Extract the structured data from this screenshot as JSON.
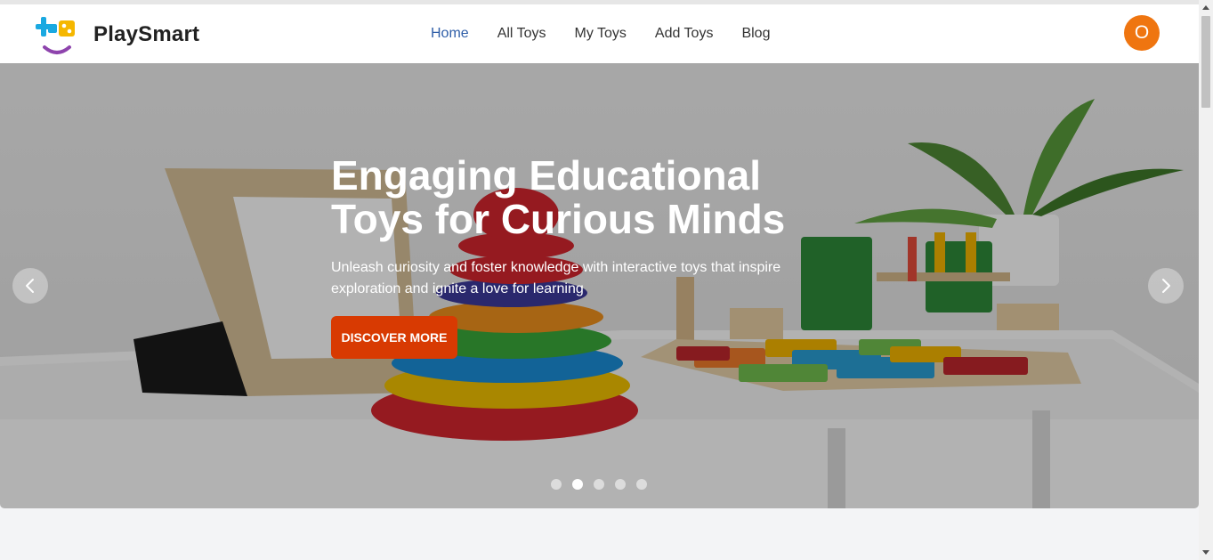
{
  "brand": {
    "name": "PlaySmart",
    "logo_icon": "toy-blocks-smile-logo"
  },
  "nav": {
    "links": [
      {
        "label": "Home",
        "active": true
      },
      {
        "label": "All Toys",
        "active": false
      },
      {
        "label": "My Toys",
        "active": false
      },
      {
        "label": "Add Toys",
        "active": false
      },
      {
        "label": "Blog",
        "active": false
      }
    ],
    "active_color": "#2f5ea8"
  },
  "user": {
    "avatar_text": "O",
    "avatar_color": "#ef7510"
  },
  "hero": {
    "title_line1": "Engaging Educational",
    "title_line2": "Toys for Curious Minds",
    "subtitle_line1": "Unleash curiosity and foster knowledge with interactive toys that inspire",
    "subtitle_line2": "exploration and ignite a love for learning",
    "cta_label": "DISCOVER MORE",
    "cta_color": "#d83a02",
    "prev_icon": "chevron-left-icon",
    "next_icon": "chevron-right-icon",
    "slides_count": 5,
    "active_slide": 2
  }
}
